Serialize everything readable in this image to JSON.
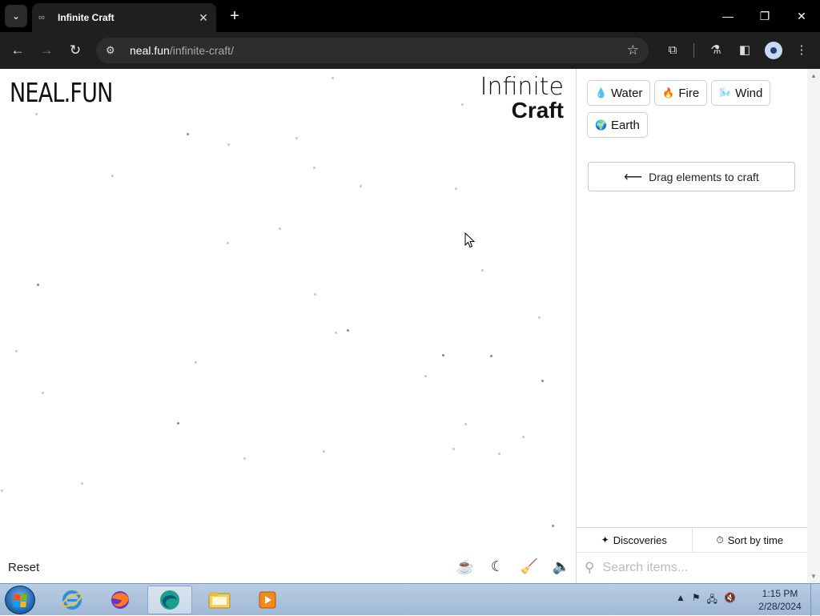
{
  "browser": {
    "tab_title": "Infinite Craft",
    "tab_favicon": "∞",
    "url_host": "neal.fun",
    "url_path": "/infinite-craft/"
  },
  "page": {
    "brand": "NEAL.FUN",
    "logo_line1": "Infinite",
    "logo_line2": "Craft",
    "reset_label": "Reset"
  },
  "sidebar": {
    "items": [
      {
        "emoji": "💧",
        "label": "Water"
      },
      {
        "emoji": "🔥",
        "label": "Fire"
      },
      {
        "emoji": "🌬️",
        "label": "Wind"
      },
      {
        "emoji": "🌍",
        "label": "Earth"
      }
    ],
    "hint_arrow": "⟵",
    "hint_label": "Drag elements to craft",
    "tab_discoveries": "Discoveries",
    "tab_sort": "Sort by time",
    "search_placeholder": "Search items..."
  },
  "taskbar": {
    "time": "1:15 PM",
    "date": "2/28/2024"
  }
}
